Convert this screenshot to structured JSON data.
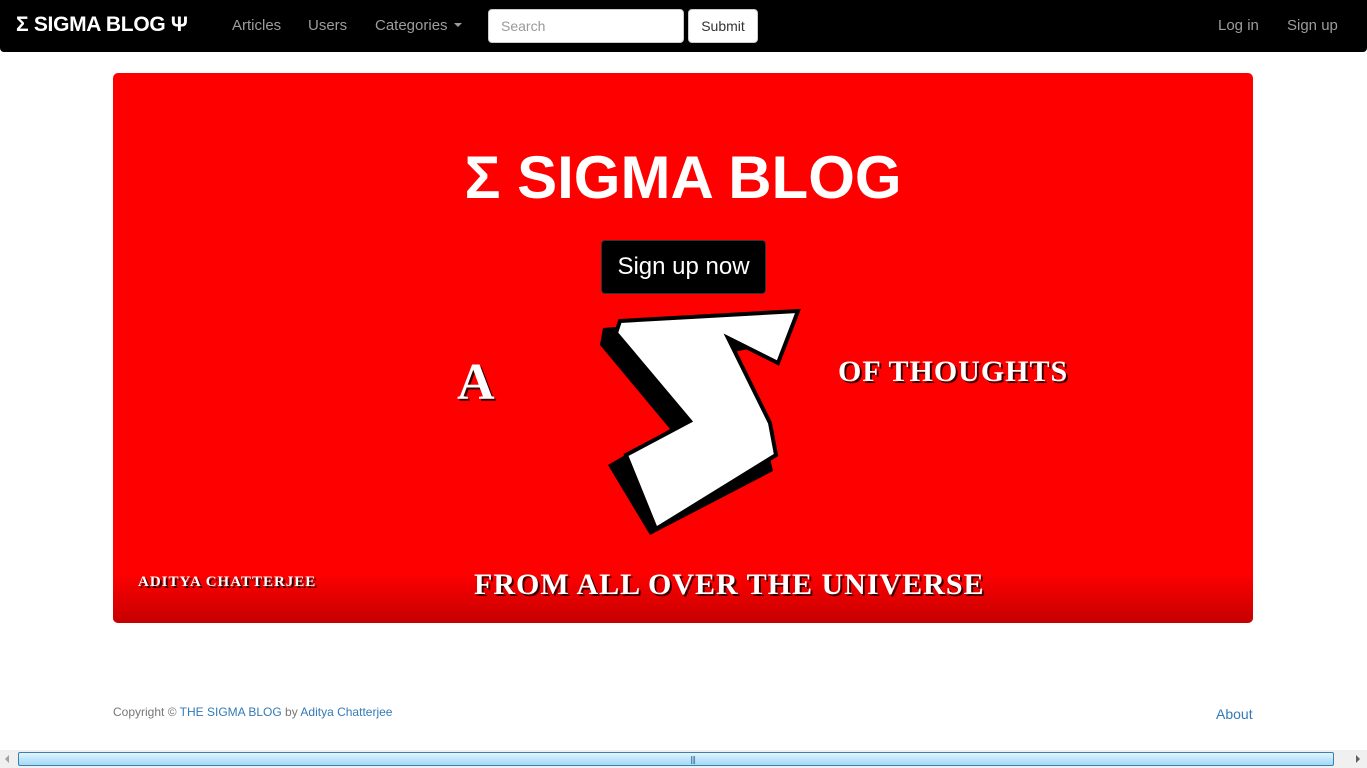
{
  "navbar": {
    "brand": "Σ SIGMA BLOG Ψ",
    "links": {
      "articles": "Articles",
      "users": "Users",
      "categories": "Categories"
    },
    "search": {
      "placeholder": "Search"
    },
    "submit_label": "Submit",
    "login": "Log in",
    "signup": "Sign up"
  },
  "hero": {
    "title": "Σ SIGMA BLOG",
    "signup_button": "Sign up now",
    "art_text": {
      "a": "A",
      "of_thoughts": "OF THOUGHTS",
      "author": "ADITYA CHATTERJEE",
      "from": "FROM ALL OVER THE UNIVERSE"
    },
    "background_color": "#ff0000"
  },
  "footer": {
    "copyright_prefix": "Copyright ©",
    "site_name": "THE SIGMA BLOG",
    "by": "by",
    "author": "Aditya Chatterjee",
    "about": "About"
  },
  "colors": {
    "navbar_bg": "#000000",
    "link_blue": "#337ab7",
    "muted_nav": "#9d9d9d"
  }
}
